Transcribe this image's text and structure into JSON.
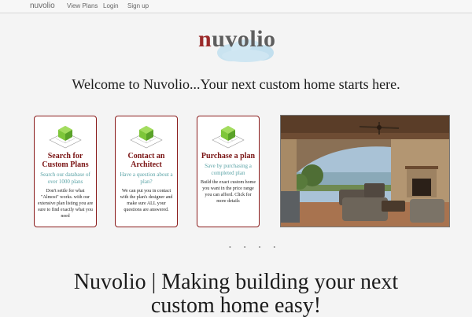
{
  "nav": {
    "brand": "nuvolio",
    "links": [
      "View Plans",
      "Login",
      "Sign up"
    ]
  },
  "logo": {
    "accent_letter": "n",
    "rest": "uvolio",
    "accent_color": "#9b2a2a"
  },
  "welcome": "Welcome to Nuvolio...Your next custom home starts here.",
  "cards": [
    {
      "title": "Search for Custom Plans",
      "subtitle": "Search our database of over 1000 plans",
      "body": "Don't settle for what \"Almost\" works. with our extensive plan listing you are sure to find exactly what you need"
    },
    {
      "title": "Contact an Architect",
      "subtitle": "Have a question about a plan?",
      "body": "We can put you in contact with the plan's designer and make sure ALL your questions are answered."
    },
    {
      "title": "Purchase a plan",
      "subtitle": "Save by purchasing a completed plan",
      "body": "Build the exact custom home you want in the price range you can afford. Click for more details"
    }
  ],
  "carousel": {
    "dots": "• • • •"
  },
  "tagline": "Nuvolio | Making building your next custom home easy!",
  "colors": {
    "card_border": "#8a1c1c",
    "card_title": "#7a1414",
    "card_subtitle": "#5aa3a6"
  },
  "icons": {
    "card": "house-plan-icon"
  }
}
